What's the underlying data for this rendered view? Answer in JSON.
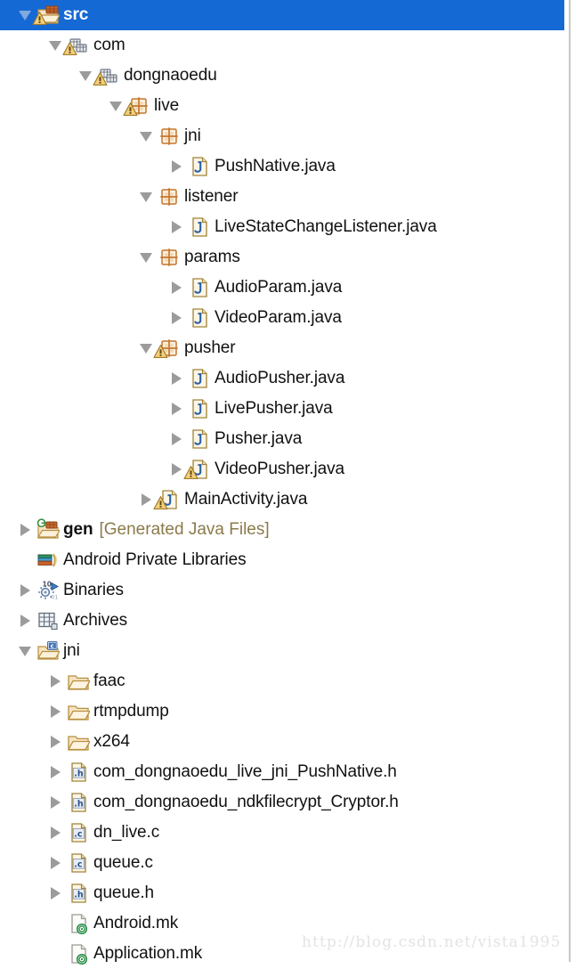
{
  "view": {
    "name": "package-explorer",
    "selected_row": "src",
    "selection_color": "#1569d4",
    "background": "#ffffff",
    "text_color": "#111111",
    "decoration_text_color": "#8b7a4a",
    "twisty_color": "#9b9b9b"
  },
  "watermark": {
    "text": "http://blog.csdn.net/vista1995",
    "color": "#e3e3e3"
  },
  "rows": [
    {
      "label": "src",
      "decoration": "",
      "icon": "source-folder-icon",
      "depth": 1,
      "twisty": "expanded",
      "selected": true,
      "warning": true,
      "bold": true
    },
    {
      "label": "com",
      "decoration": "",
      "icon": "package-icon",
      "depth": 2,
      "twisty": "expanded",
      "selected": false,
      "warning": true,
      "bold": false
    },
    {
      "label": "dongnaoedu",
      "decoration": "",
      "icon": "package-icon",
      "depth": 3,
      "twisty": "expanded",
      "selected": false,
      "warning": true,
      "bold": false
    },
    {
      "label": "live",
      "decoration": "",
      "icon": "package-grid-icon",
      "depth": 4,
      "twisty": "expanded",
      "selected": false,
      "warning": true,
      "bold": false
    },
    {
      "label": "jni",
      "decoration": "",
      "icon": "package-grid-icon",
      "depth": 5,
      "twisty": "expanded",
      "selected": false,
      "warning": false,
      "bold": false
    },
    {
      "label": "PushNative.java",
      "decoration": "",
      "icon": "java-file-icon",
      "depth": 6,
      "twisty": "collapsed",
      "selected": false,
      "warning": false,
      "bold": false
    },
    {
      "label": "listener",
      "decoration": "",
      "icon": "package-grid-icon",
      "depth": 5,
      "twisty": "expanded",
      "selected": false,
      "warning": false,
      "bold": false
    },
    {
      "label": "LiveStateChangeListener.java",
      "decoration": "",
      "icon": "java-file-icon",
      "depth": 6,
      "twisty": "collapsed",
      "selected": false,
      "warning": false,
      "bold": false
    },
    {
      "label": "params",
      "decoration": "",
      "icon": "package-grid-icon",
      "depth": 5,
      "twisty": "expanded",
      "selected": false,
      "warning": false,
      "bold": false
    },
    {
      "label": "AudioParam.java",
      "decoration": "",
      "icon": "java-file-icon",
      "depth": 6,
      "twisty": "collapsed",
      "selected": false,
      "warning": false,
      "bold": false
    },
    {
      "label": "VideoParam.java",
      "decoration": "",
      "icon": "java-file-icon",
      "depth": 6,
      "twisty": "collapsed",
      "selected": false,
      "warning": false,
      "bold": false
    },
    {
      "label": "pusher",
      "decoration": "",
      "icon": "package-grid-icon",
      "depth": 5,
      "twisty": "expanded",
      "selected": false,
      "warning": true,
      "bold": false
    },
    {
      "label": "AudioPusher.java",
      "decoration": "",
      "icon": "java-file-icon",
      "depth": 6,
      "twisty": "collapsed",
      "selected": false,
      "warning": false,
      "bold": false
    },
    {
      "label": "LivePusher.java",
      "decoration": "",
      "icon": "java-file-icon",
      "depth": 6,
      "twisty": "collapsed",
      "selected": false,
      "warning": false,
      "bold": false
    },
    {
      "label": "Pusher.java",
      "decoration": "",
      "icon": "java-file-icon",
      "depth": 6,
      "twisty": "collapsed",
      "selected": false,
      "warning": false,
      "bold": false
    },
    {
      "label": "VideoPusher.java",
      "decoration": "",
      "icon": "java-file-icon",
      "depth": 6,
      "twisty": "collapsed",
      "selected": false,
      "warning": true,
      "bold": false
    },
    {
      "label": "MainActivity.java",
      "decoration": "",
      "icon": "java-file-icon",
      "depth": 5,
      "twisty": "collapsed",
      "selected": false,
      "warning": true,
      "bold": false
    },
    {
      "label": "gen",
      "decoration": "[Generated Java Files]",
      "icon": "gen-folder-icon",
      "depth": 1,
      "twisty": "collapsed",
      "selected": false,
      "warning": false,
      "bold": true
    },
    {
      "label": "Android Private Libraries",
      "decoration": "",
      "icon": "library-books-icon",
      "depth": 1,
      "twisty": "none",
      "selected": false,
      "warning": false,
      "bold": false
    },
    {
      "label": "Binaries",
      "decoration": "",
      "icon": "binaries-icon",
      "depth": 1,
      "twisty": "collapsed",
      "selected": false,
      "warning": false,
      "bold": false
    },
    {
      "label": "Archives",
      "decoration": "",
      "icon": "archives-icon",
      "depth": 1,
      "twisty": "collapsed",
      "selected": false,
      "warning": false,
      "bold": false
    },
    {
      "label": "jni",
      "decoration": "",
      "icon": "c-folder-icon",
      "depth": 1,
      "twisty": "expanded",
      "selected": false,
      "warning": false,
      "bold": false
    },
    {
      "label": "faac",
      "decoration": "",
      "icon": "folder-icon",
      "depth": 2,
      "twisty": "collapsed",
      "selected": false,
      "warning": false,
      "bold": false
    },
    {
      "label": "rtmpdump",
      "decoration": "",
      "icon": "folder-icon",
      "depth": 2,
      "twisty": "collapsed",
      "selected": false,
      "warning": false,
      "bold": false
    },
    {
      "label": "x264",
      "decoration": "",
      "icon": "folder-icon",
      "depth": 2,
      "twisty": "collapsed",
      "selected": false,
      "warning": false,
      "bold": false
    },
    {
      "label": "com_dongnaoedu_live_jni_PushNative.h",
      "decoration": "",
      "icon": "h-file-icon",
      "depth": 2,
      "twisty": "collapsed",
      "selected": false,
      "warning": false,
      "bold": false
    },
    {
      "label": "com_dongnaoedu_ndkfilecrypt_Cryptor.h",
      "decoration": "",
      "icon": "h-file-icon",
      "depth": 2,
      "twisty": "collapsed",
      "selected": false,
      "warning": false,
      "bold": false
    },
    {
      "label": "dn_live.c",
      "decoration": "",
      "icon": "c-file-icon",
      "depth": 2,
      "twisty": "collapsed",
      "selected": false,
      "warning": false,
      "bold": false
    },
    {
      "label": "queue.c",
      "decoration": "",
      "icon": "c-file-icon",
      "depth": 2,
      "twisty": "collapsed",
      "selected": false,
      "warning": false,
      "bold": false
    },
    {
      "label": "queue.h",
      "decoration": "",
      "icon": "h-file-icon",
      "depth": 2,
      "twisty": "collapsed",
      "selected": false,
      "warning": false,
      "bold": false
    },
    {
      "label": "Android.mk",
      "decoration": "",
      "icon": "mk-file-icon",
      "depth": 2,
      "twisty": "none",
      "selected": false,
      "warning": false,
      "bold": false
    },
    {
      "label": "Application.mk",
      "decoration": "",
      "icon": "mk-file-icon",
      "depth": 2,
      "twisty": "none",
      "selected": false,
      "warning": false,
      "bold": false
    }
  ]
}
